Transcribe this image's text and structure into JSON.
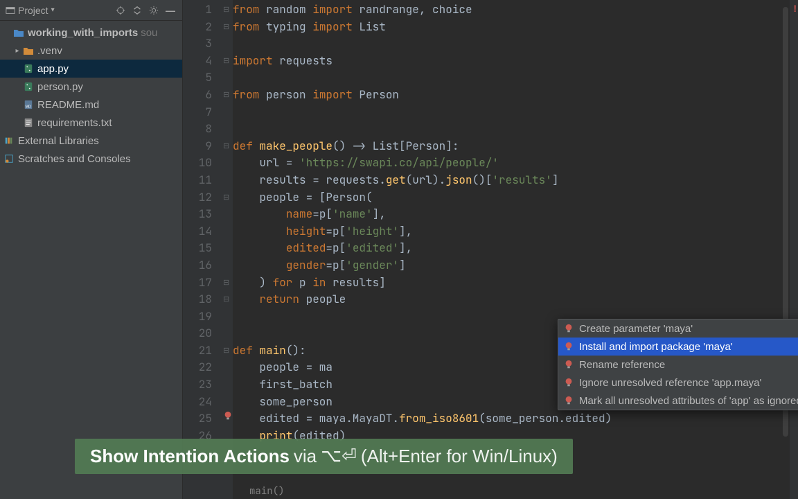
{
  "sidebar": {
    "header_title": "Project",
    "root": {
      "name": "working_with_imports",
      "hint": "sou"
    },
    "venv": ".venv",
    "files": {
      "app": "app.py",
      "person": "person.py",
      "readme": "README.md",
      "requirements": "requirements.txt"
    },
    "external": "External Libraries",
    "scratches": "Scratches and Consoles"
  },
  "code": {
    "lines": [
      "from random import randrange, choice",
      "from typing import List",
      "",
      "import requests",
      "",
      "from person import Person",
      "",
      "",
      "def make_people() -> List[Person]:",
      "    url = 'https://swapi.co/api/people/'",
      "    results = requests.get(url).json()['results']",
      "    people = [Person(",
      "        name=p['name'],",
      "        height=p['height'],",
      "        edited=p['edited'],",
      "        gender=p['gender']",
      "    ) for p in results]",
      "    return people",
      "",
      "",
      "def main():",
      "    people = ma",
      "    first_batch",
      "    some_person",
      "    edited = maya.MayaDT.from_iso8601(some_person.edited)",
      "    print(edited)"
    ]
  },
  "popup": {
    "items": [
      "Create parameter 'maya'",
      "Install and import package 'maya'",
      "Rename reference",
      "Ignore unresolved reference 'app.maya'",
      "Mark all unresolved attributes of 'app' as ignored"
    ],
    "selected": 1
  },
  "breadcrumb": "main()",
  "banner": {
    "strong": "Show Intention Actions",
    "via": " via ",
    "mac_key": "⌥⏎",
    "rest": " (Alt+Enter for Win/Linux)"
  }
}
